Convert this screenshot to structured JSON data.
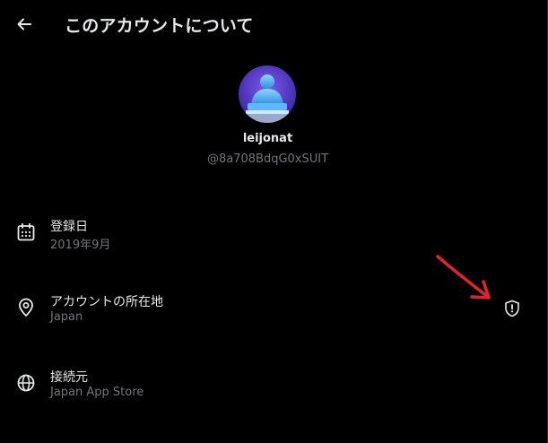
{
  "header": {
    "title": "このアカウントについて",
    "back_icon": "arrow-left-icon"
  },
  "profile": {
    "name": "leijonat",
    "handle": "@8a708BdqG0xSUIT",
    "avatar_background": "#5b3fc7"
  },
  "info": [
    {
      "icon": "calendar-icon",
      "label": "登録日",
      "value": "2019年9月"
    },
    {
      "icon": "location-pin-icon",
      "label": "アカウントの所在地",
      "value": "Japan",
      "trailing_icon": "shield-alert-icon"
    },
    {
      "icon": "globe-icon",
      "label": "接続元",
      "value": "Japan App Store"
    }
  ],
  "colors": {
    "background": "#000000",
    "primary_text": "#e7e9ea",
    "secondary_text": "#71767b",
    "annotation_arrow": "#e0242b"
  }
}
